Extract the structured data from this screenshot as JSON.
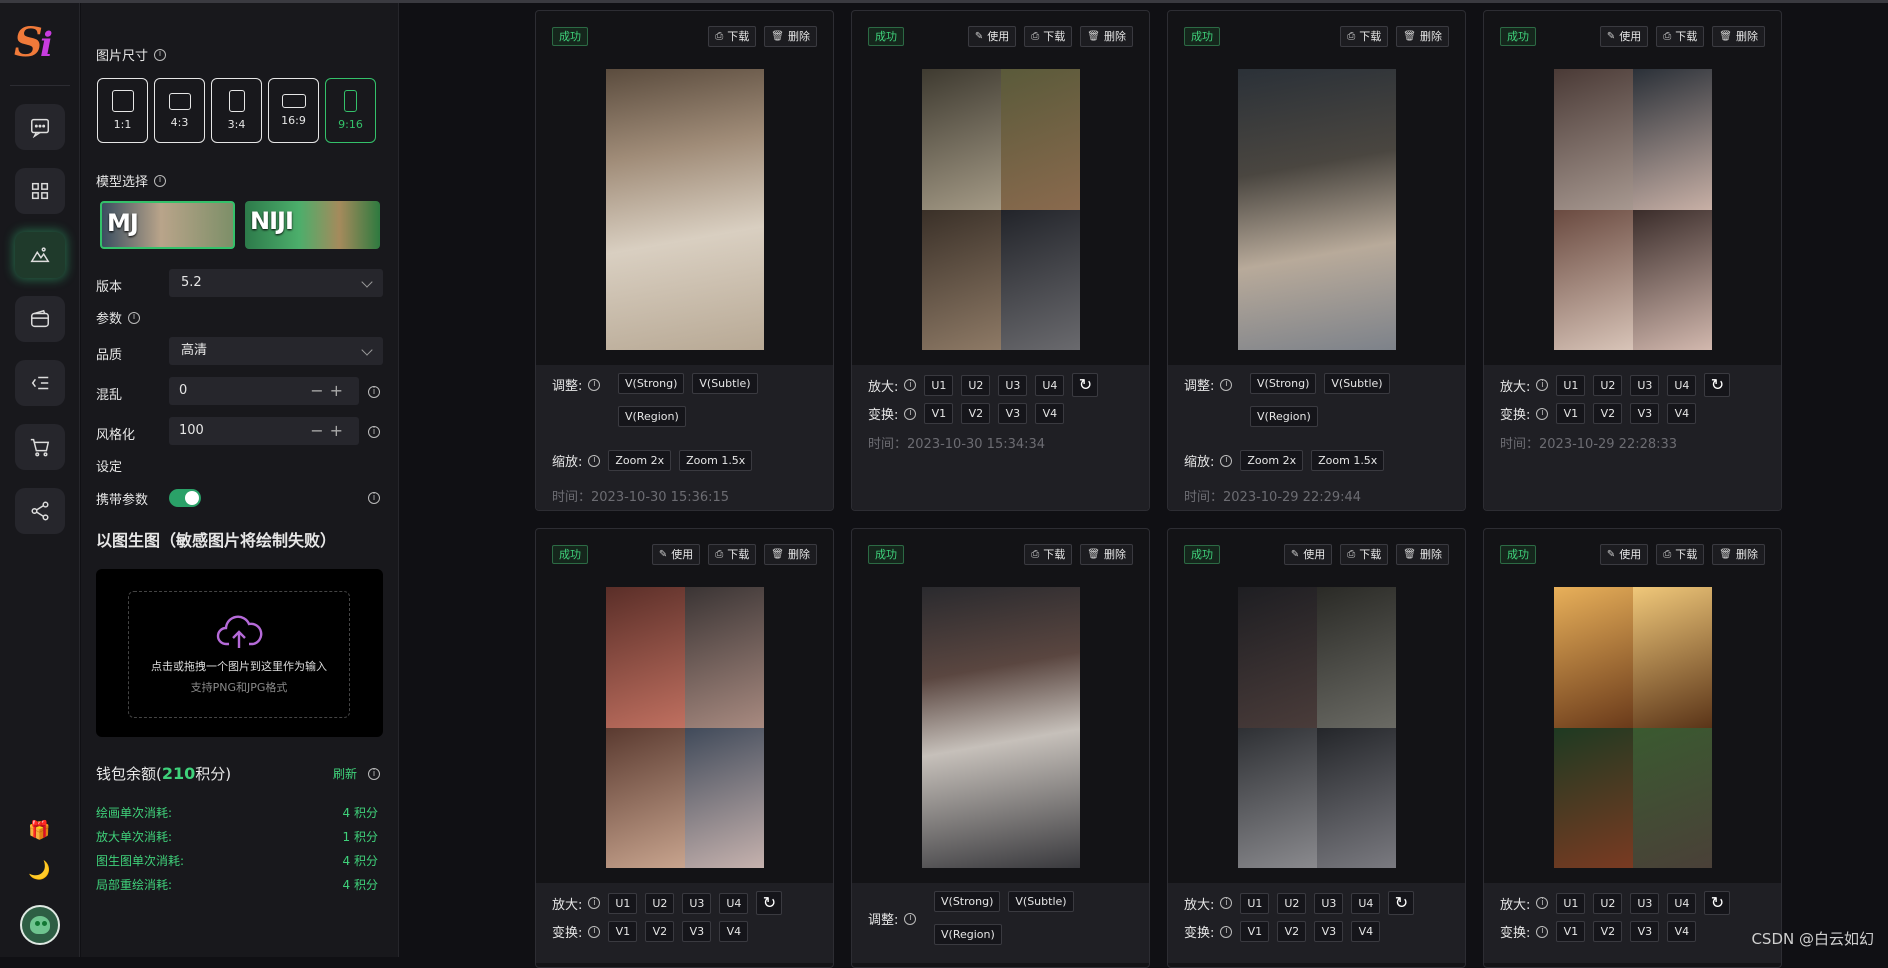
{
  "colors": {
    "accent": "#34c16a",
    "bg": "#101014",
    "panel": "#18181c"
  },
  "nav": {
    "icons": [
      "chat-icon",
      "grid-icon",
      "image-gen-icon",
      "wallet-icon",
      "list-icon",
      "cart-icon",
      "share-icon",
      "gift-icon",
      "moon-icon"
    ]
  },
  "panel": {
    "size_label": "图片尺寸",
    "sizes": [
      "1:1",
      "4:3",
      "3:4",
      "16:9",
      "9:16"
    ],
    "model_label": "模型选择",
    "models": [
      "MJ",
      "NIJI"
    ],
    "version_label": "版本",
    "version_value": "5.2",
    "params_label": "参数",
    "quality_label": "品质",
    "quality_value": "高清",
    "chaos_label": "混乱",
    "chaos_value": "0",
    "stylize_label": "风格化",
    "stylize_value": "100",
    "settings_label": "设定",
    "carry_label": "携带参数",
    "img2img_title": "以图生图（敏感图片将绘制失败）",
    "upload_line1": "点击或拖拽一个图片到这里作为输入",
    "upload_line2": "支持PNG和JPG格式",
    "wallet_prefix": "钱包余额(",
    "wallet_points": "210",
    "wallet_suffix": "积分)",
    "refresh_label": "刷新",
    "costs": [
      {
        "k": "绘画单次消耗:",
        "v": "4 积分"
      },
      {
        "k": "放大单次消耗:",
        "v": "1 积分"
      },
      {
        "k": "图生图单次消耗:",
        "v": "4 积分"
      },
      {
        "k": "局部重绘消耗:",
        "v": "4 积分"
      }
    ]
  },
  "labels": {
    "status": "成功",
    "use": "使用",
    "download": "下载",
    "delete": "删除",
    "adjust": "调整:",
    "zoom": "缩放:",
    "upscale": "放大:",
    "vary": "变换:",
    "v_strong": "V(Strong)",
    "v_subtle": "V(Subtle)",
    "v_region": "V(Region)",
    "zoom2": "Zoom 2x",
    "zoom15": "Zoom 1.5x",
    "u": [
      "U1",
      "U2",
      "U3",
      "U4"
    ],
    "v": [
      "V1",
      "V2",
      "V3",
      "V4"
    ]
  },
  "cards": [
    {
      "time": "时间：2023-10-30 15:36:15"
    },
    {
      "time": "时间：2023-10-30 15:34:34"
    },
    {
      "time": "时间：2023-10-29 22:29:44"
    },
    {
      "time": "时间：2023-10-29 22:28:33"
    }
  ],
  "watermark": "CSDN @白云如幻"
}
